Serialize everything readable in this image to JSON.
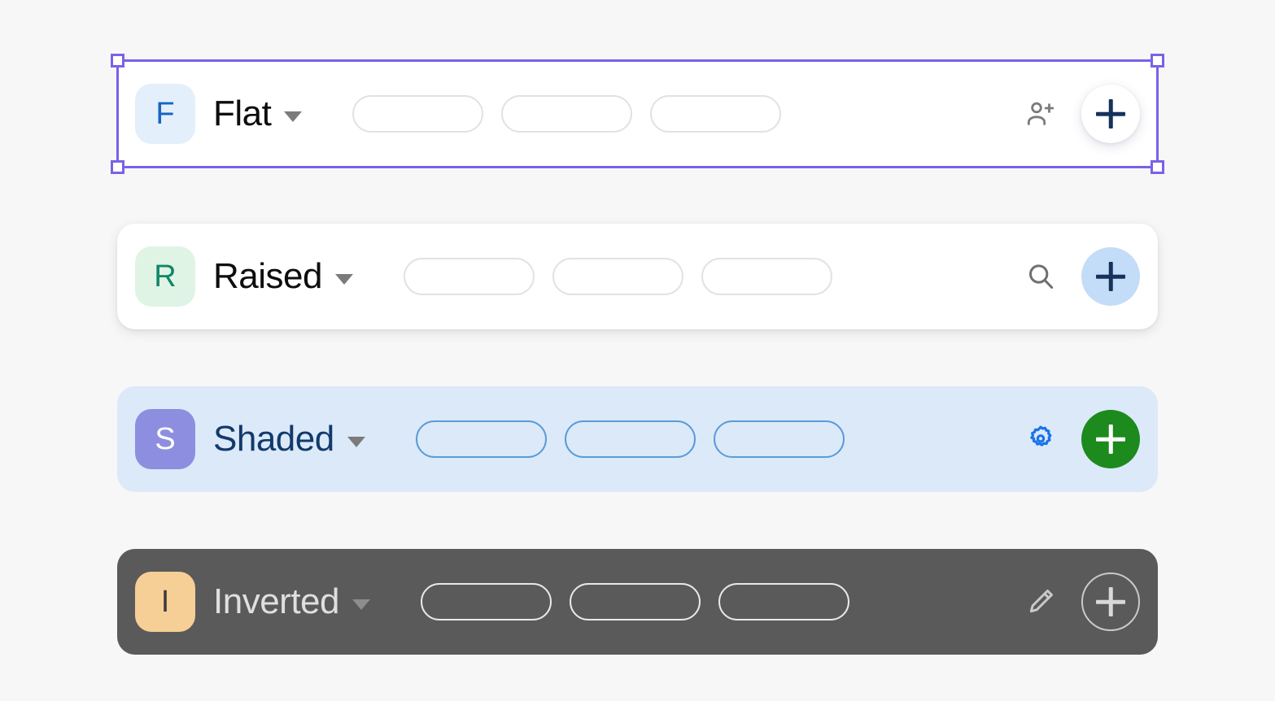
{
  "page": {
    "background": "#f7f7f8",
    "selection_color": "#7b61e8"
  },
  "rows": [
    {
      "key": "flat",
      "style_name": "Flat",
      "badge_letter": "F",
      "badge_bg": "#e3effb",
      "badge_color": "#1766c0",
      "title": "Flat",
      "title_color": "#0d0d0d",
      "caret": "chevron-down-icon",
      "background": "#ffffff",
      "pill_border": "#dcdcdc",
      "pill_count": 3,
      "tool_icon": "person-add-icon",
      "tool_icon_color": "#7b7b7b",
      "fab_label": "+",
      "fab_bg": "#ffffff",
      "fab_plus_color": "#16325c",
      "selected": true
    },
    {
      "key": "raised",
      "style_name": "Raised",
      "badge_letter": "R",
      "badge_bg": "#dff4e4",
      "badge_color": "#10856a",
      "title": "Raised",
      "title_color": "#0d0d0d",
      "caret": "chevron-down-icon",
      "background": "#ffffff",
      "pill_border": "#dcdcdc",
      "pill_count": 3,
      "tool_icon": "search-icon",
      "tool_icon_color": "#6f6f6f",
      "fab_label": "+",
      "fab_bg": "#c3dcf7",
      "fab_plus_color": "#16325c",
      "selected": false
    },
    {
      "key": "shaded",
      "style_name": "Shaded",
      "badge_letter": "S",
      "badge_bg": "#8e8ee0",
      "badge_color": "#ffffff",
      "title": "Shaded",
      "title_color": "#123a6b",
      "caret": "chevron-down-icon",
      "background": "#dce9f9",
      "pill_border": "#5b9bd8",
      "pill_count": 3,
      "tool_icon": "gear-icon",
      "tool_icon_color": "#1a73e8",
      "fab_label": "+",
      "fab_bg": "#1c8a1c",
      "fab_plus_color": "#ffffff",
      "selected": false
    },
    {
      "key": "inverted",
      "style_name": "Inverted",
      "badge_letter": "I",
      "badge_bg": "#f6cf96",
      "badge_color": "#3b3b3b",
      "title": "Inverted",
      "title_color": "#dfdfdf",
      "caret": "chevron-down-icon",
      "background": "#5a5a5a",
      "pill_border": "#e8e8e8",
      "pill_count": 3,
      "tool_icon": "pencil-icon",
      "tool_icon_color": "#c9c9c9",
      "fab_label": "+",
      "fab_bg": "transparent",
      "fab_plus_color": "#d8d8d8",
      "selected": false
    }
  ]
}
